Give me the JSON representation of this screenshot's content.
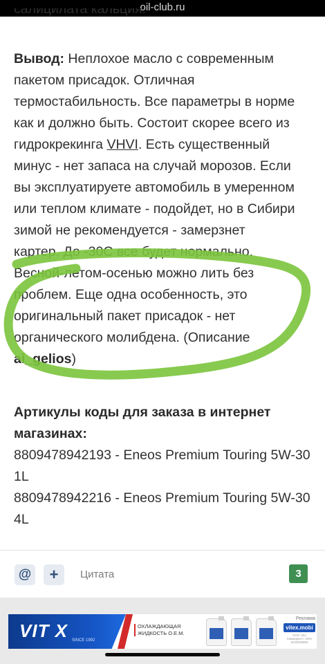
{
  "browser": {
    "url": "oil-club.ru"
  },
  "article": {
    "partial_line": "салицилата кальция.",
    "conclusion_label": "Вывод:",
    "lines": [
      " Неплохое масло с современным",
      "пакетом присадок. Отличная",
      "термостабильность. Все параметры в норме",
      "как и должно быть. Состоит скорее всего из",
      "гидрокрекинга ",
      "VHVI",
      ". Есть существенный",
      "минус - нет запаса на случай морозов. Если",
      "вы эксплуатируете автомобиль в умеренном",
      "или теплом климате - подойдет, но в Сибири",
      "зимой не рекомендуется - замерзнет",
      "картер. До -30С все будет нормально.",
      "Весной-летом-осенью можно лить без",
      "проблем. Еще одна особенность, это",
      "оригинальный пакет присадок - нет",
      "органического молибдена. (Описание"
    ],
    "author_link": "ai_gelios",
    "author_close": ")"
  },
  "articles": {
    "heading": "Артикулы коды для заказа в интернет магазинах:",
    "items": [
      "8809478942193 - Eneos Premium Touring 5W-30 1L",
      "8809478942216 - Eneos Premium Touring 5W-30 4L"
    ]
  },
  "actions": {
    "mention_icon": "@",
    "add_icon": "+",
    "quote_label": "Цитата",
    "like_count": "3"
  },
  "ad": {
    "brand": "VIT X",
    "brand_since": "SINCE 1992",
    "tagline": "ОХЛАЖДАЮЩАЯ ЖИДКОСТЬ О.Е.М.",
    "label": "Реклама",
    "site": "vitex.mobi",
    "fine_print": "ООО «Вл Химмаркет» ИНН 5249159963"
  },
  "colors": {
    "highlight": "#7bc43c",
    "badge": "#3f8f52",
    "link": "#303030"
  }
}
